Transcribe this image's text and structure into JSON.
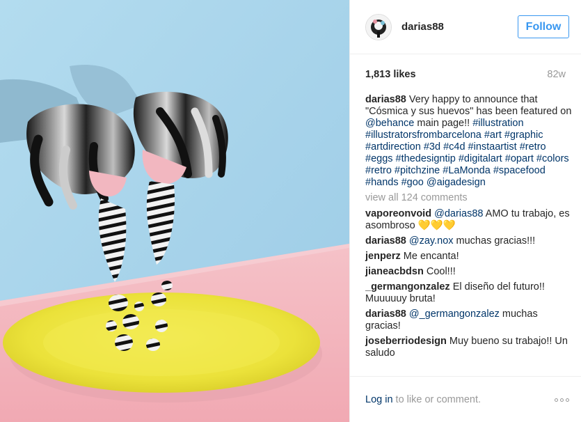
{
  "post": {
    "username": "darias88",
    "follow_label": "Follow",
    "likes": "1,813 likes",
    "time_ago": "82w",
    "caption": {
      "user": "darias88",
      "parts": [
        {
          "text": "Very happy to announce that \"Cósmica y sus huevos\" has been featured on ",
          "link": false
        },
        {
          "text": "@behance",
          "link": true
        },
        {
          "text": " main page!! ",
          "link": false
        },
        {
          "text": "#illustration",
          "link": true
        },
        {
          "text": " ",
          "link": false
        },
        {
          "text": "#illustratorsfrombarcelona",
          "link": true
        },
        {
          "text": " ",
          "link": false
        },
        {
          "text": "#art",
          "link": true
        },
        {
          "text": " ",
          "link": false
        },
        {
          "text": "#graphic",
          "link": true
        },
        {
          "text": " ",
          "link": false
        },
        {
          "text": "#artdirection",
          "link": true
        },
        {
          "text": " ",
          "link": false
        },
        {
          "text": "#3d",
          "link": true
        },
        {
          "text": " ",
          "link": false
        },
        {
          "text": "#c4d",
          "link": true
        },
        {
          "text": " ",
          "link": false
        },
        {
          "text": "#instaartist",
          "link": true
        },
        {
          "text": " ",
          "link": false
        },
        {
          "text": "#retro",
          "link": true
        },
        {
          "text": " ",
          "link": false
        },
        {
          "text": "#eggs",
          "link": true
        },
        {
          "text": " ",
          "link": false
        },
        {
          "text": "#thedesigntip",
          "link": true
        },
        {
          "text": " ",
          "link": false
        },
        {
          "text": "#digitalart",
          "link": true
        },
        {
          "text": " ",
          "link": false
        },
        {
          "text": "#opart",
          "link": true
        },
        {
          "text": " ",
          "link": false
        },
        {
          "text": "#colors",
          "link": true
        },
        {
          "text": " ",
          "link": false
        },
        {
          "text": "#retro",
          "link": true
        },
        {
          "text": " ",
          "link": false
        },
        {
          "text": "#pitchzine",
          "link": true
        },
        {
          "text": " ",
          "link": false
        },
        {
          "text": "#LaMonda",
          "link": true
        },
        {
          "text": " ",
          "link": false
        },
        {
          "text": "#spacefood",
          "link": true
        },
        {
          "text": " ",
          "link": false
        },
        {
          "text": "#hands",
          "link": true
        },
        {
          "text": " ",
          "link": false
        },
        {
          "text": "#goo",
          "link": true
        },
        {
          "text": " ",
          "link": false
        },
        {
          "text": "@aigadesign",
          "link": true
        }
      ]
    },
    "view_all": "view all 124 comments",
    "comments": [
      {
        "user": "vaporeonvoid",
        "parts": [
          {
            "text": "@darias88",
            "link": true
          },
          {
            "text": " AMO tu trabajo, es asombroso 💛💛💛",
            "link": false
          }
        ]
      },
      {
        "user": "darias88",
        "parts": [
          {
            "text": "@zay.nox",
            "link": true
          },
          {
            "text": " muchas gracias!!!",
            "link": false
          }
        ]
      },
      {
        "user": "jenperz",
        "parts": [
          {
            "text": "Me encanta!",
            "link": false
          }
        ]
      },
      {
        "user": "jianeacbdsn",
        "parts": [
          {
            "text": "Cool!!!",
            "link": false
          }
        ]
      },
      {
        "user": "_germangonzalez",
        "parts": [
          {
            "text": "El diseño del futuro!! Muuuuuy bruta!",
            "link": false
          }
        ]
      },
      {
        "user": "darias88",
        "parts": [
          {
            "text": "@_germangonzalez",
            "link": true
          },
          {
            "text": " muchas gracias!",
            "link": false
          }
        ]
      },
      {
        "user": "joseberriodesign",
        "parts": [
          {
            "text": "Muy bueno su trabajo!! Un saludo",
            "link": false
          }
        ]
      }
    ],
    "login_link": "Log in",
    "login_suffix": " to like or comment.",
    "more_icon": "more-options-icon"
  },
  "colors": {
    "link": "#003569",
    "follow_blue": "#3897f0",
    "muted": "#999999",
    "sky": "#a9d3ea",
    "pink_table": "#f4b3bd",
    "plate_yellow": "#ede63a"
  }
}
